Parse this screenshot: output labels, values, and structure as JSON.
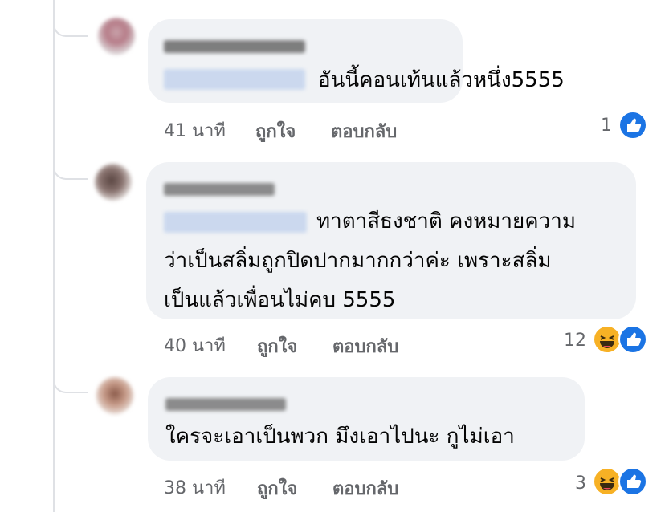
{
  "comments": [
    {
      "text_lines": [
        "อันนี้คอนเท้นแล้วหนึ่ง5555"
      ],
      "time": "41 นาที",
      "like_label": "ถูกใจ",
      "reply_label": "ตอบกลับ",
      "reaction_count": "1",
      "reactions": [
        "like-icon"
      ]
    },
    {
      "text_lines": [
        "ทาตาสีธงชาติ คงหมายความ",
        "ว่าเป็นสลิ่มถูกปิดปากมากกว่าค่ะ เพราะสลิ่ม",
        "เป็นแล้วเพื่อนไม่คบ 5555"
      ],
      "time": "40 นาที",
      "like_label": "ถูกใจ",
      "reply_label": "ตอบกลับ",
      "reaction_count": "12",
      "reactions": [
        "haha-icon",
        "like-icon"
      ]
    },
    {
      "text_lines": [
        "ใครจะเอาเป็นพวก มึงเอาไปนะ กูไม่เอา"
      ],
      "time": "38 นาที",
      "like_label": "ถูกใจ",
      "reply_label": "ตอบกลับ",
      "reaction_count": "3",
      "reactions": [
        "haha-icon",
        "like-icon"
      ]
    }
  ],
  "colors": {
    "bubble": "#f0f2f5",
    "meta_text": "#65676b",
    "like_blue": "#1b74e4",
    "haha_yellow": "#f7b125"
  }
}
